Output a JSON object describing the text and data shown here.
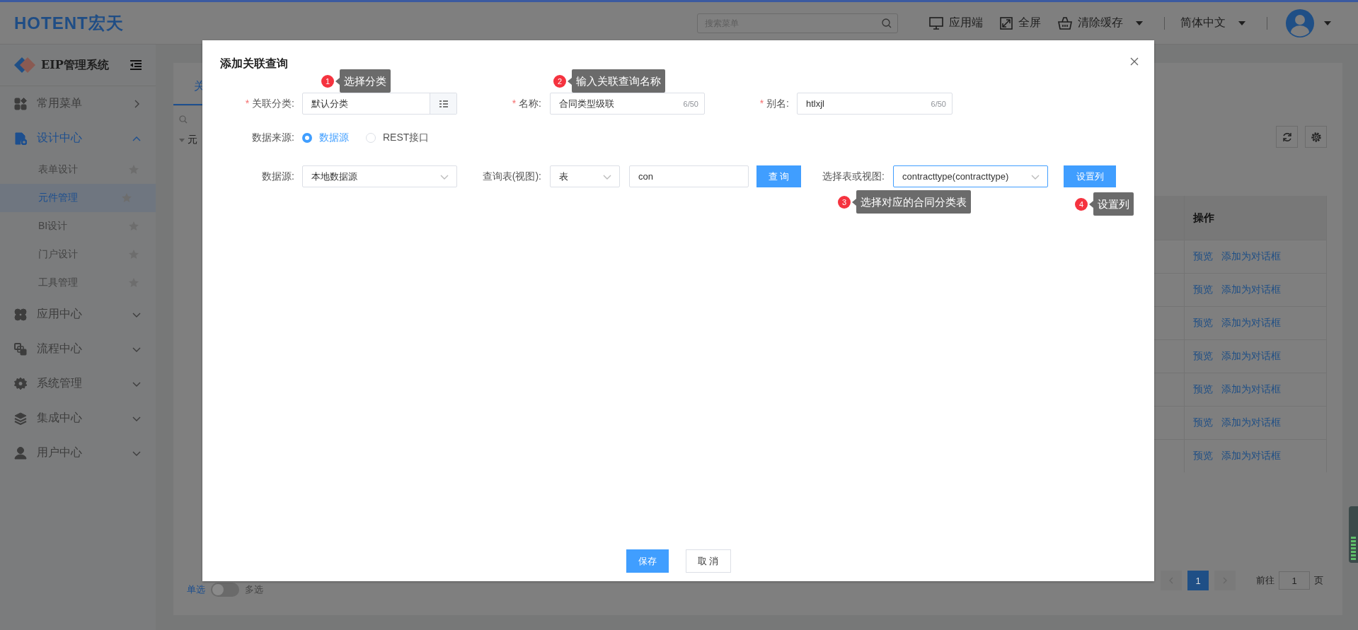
{
  "header": {
    "logo": "HOTENT宏天",
    "search": {
      "placeholder": "搜索菜单"
    },
    "actions": [
      {
        "label": "应用端",
        "dropdown": false
      },
      {
        "label": "全屏",
        "dropdown": false
      },
      {
        "label": "清除缓存",
        "dropdown": true
      }
    ],
    "language": "简体中文"
  },
  "sidebar": {
    "title": "EIP管理系统",
    "items": [
      {
        "label": "常用菜单",
        "kind": "link",
        "expanded": false
      },
      {
        "label": "设计中心",
        "kind": "group",
        "expanded": true,
        "children": [
          {
            "label": "表单设计",
            "selected": false
          },
          {
            "label": "元件管理",
            "selected": true
          },
          {
            "label": "BI设计",
            "selected": false
          },
          {
            "label": "门户设计",
            "selected": false
          },
          {
            "label": "工具管理",
            "selected": false
          }
        ]
      },
      {
        "label": "应用中心",
        "kind": "group",
        "expanded": false
      },
      {
        "label": "流程中心",
        "kind": "group",
        "expanded": false
      },
      {
        "label": "系统管理",
        "kind": "group",
        "expanded": false
      },
      {
        "label": "集成中心",
        "kind": "group",
        "expanded": false
      },
      {
        "label": "用户中心",
        "kind": "group",
        "expanded": false
      }
    ]
  },
  "page": {
    "tab": {
      "label": "关",
      "selected": true
    },
    "tree_item": "元",
    "mode": {
      "single": "单选",
      "multiple": "多选",
      "on": false
    },
    "table": {
      "columns": [
        "操作"
      ],
      "rows": [
        {
          "actions": [
            "预览",
            "添加为对话框"
          ]
        },
        {
          "actions": [
            "预览",
            "添加为对话框"
          ]
        },
        {
          "actions": [
            "预览",
            "添加为对话框"
          ]
        },
        {
          "actions": [
            "预览",
            "添加为对话框"
          ]
        },
        {
          "actions": [
            "预览",
            "添加为对话框"
          ]
        },
        {
          "actions": [
            "预览",
            "添加为对话框"
          ]
        },
        {
          "actions": [
            "预览",
            "添加为对话框"
          ]
        }
      ]
    },
    "pagination": {
      "pages": [
        {
          "label": "1",
          "selected": true
        }
      ],
      "goto_label": "前往",
      "goto_value": "1",
      "page_unit": "页"
    }
  },
  "dialog": {
    "title": "添加关联查询",
    "annotations": [
      {
        "number": "1",
        "text": "选择分类"
      },
      {
        "number": "2",
        "text": "输入关联查询名称"
      },
      {
        "number": "3",
        "text": "选择对应的合同分类表"
      },
      {
        "number": "4",
        "text": "设置列"
      }
    ],
    "category": {
      "required_mark": "*",
      "label": "关联分类:",
      "value": "默认分类"
    },
    "name": {
      "required_mark": "*",
      "label": "名称:",
      "value": "合同类型级联",
      "count": "6/50"
    },
    "alias": {
      "required_mark": "*",
      "label": "别名:",
      "value": "htlxjl",
      "count": "6/50"
    },
    "source_type": {
      "label": "数据来源:",
      "options": [
        {
          "label": "数据源",
          "selected": true
        },
        {
          "label": "REST接口",
          "selected": false
        }
      ]
    },
    "datasource": {
      "label": "数据源:",
      "value": "本地数据源"
    },
    "query_table": {
      "label": "查询表(视图):",
      "type": "表",
      "keyword": "con",
      "button": "查 询"
    },
    "table_select": {
      "label": "选择表或视图:",
      "value": "contracttype(contracttype)",
      "focused": true
    },
    "set_columns": "设置列",
    "buttons": [
      {
        "label": "保存",
        "kind": "primary"
      },
      {
        "label": "取 消",
        "kind": "default"
      }
    ]
  }
}
